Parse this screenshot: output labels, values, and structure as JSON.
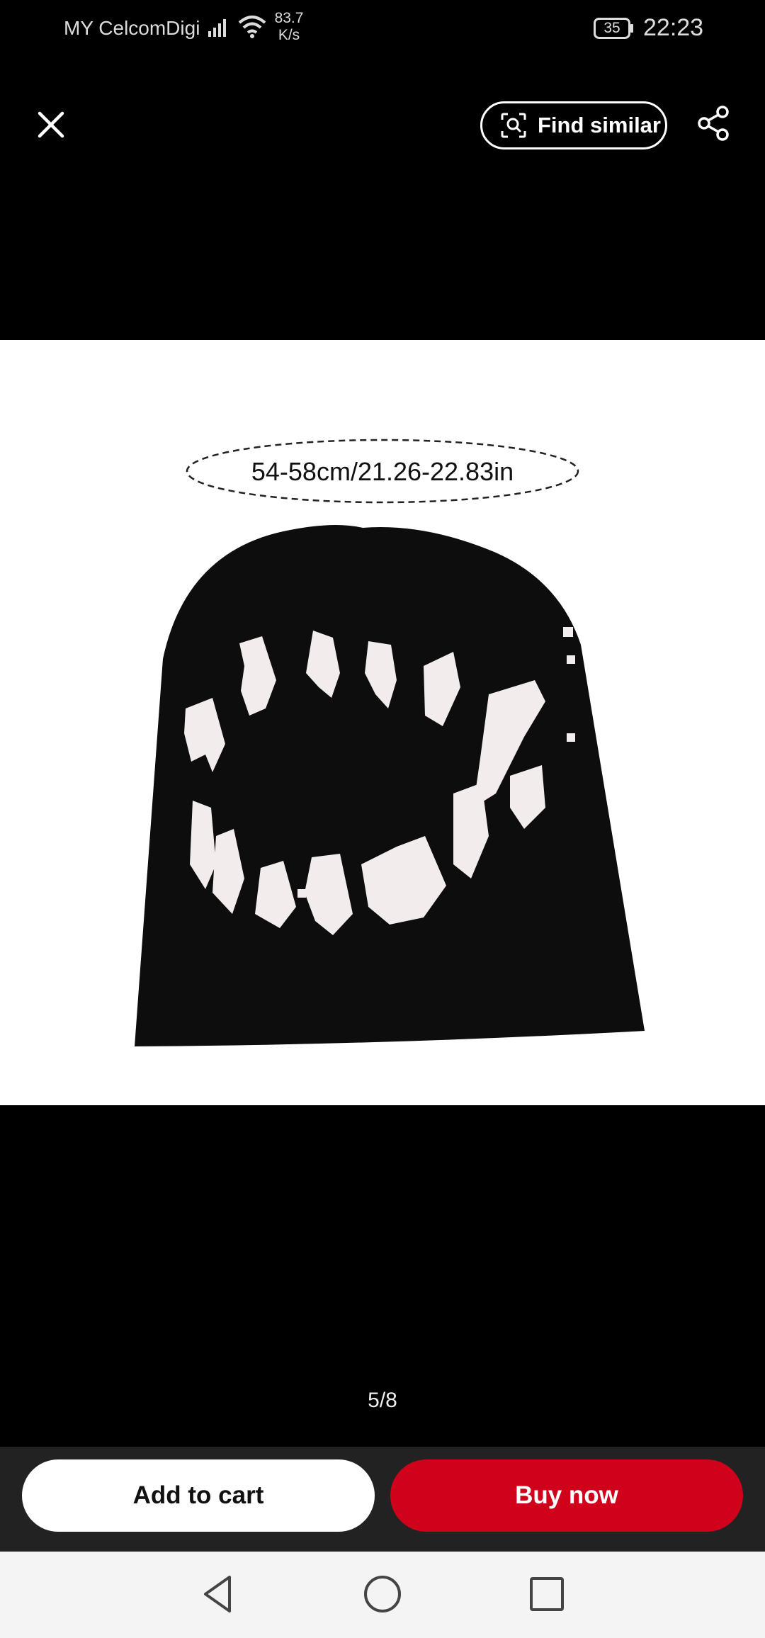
{
  "status_bar": {
    "carrier": "MY CelcomDigi",
    "speed_value": "83.7",
    "speed_unit": "K/s",
    "battery": "35",
    "time": "22:23",
    "icons": [
      "signal-icon",
      "wifi-icon",
      "battery-icon"
    ]
  },
  "toolbar": {
    "close_icon": "close-icon",
    "find_similar_label": "Find similar",
    "find_similar_icon": "scan-search-icon",
    "share_icon": "share-icon"
  },
  "image": {
    "size_label": "54-58cm/21.26-22.83in"
  },
  "gallery": {
    "counter": "5/8"
  },
  "actions": {
    "add_to_cart": "Add to cart",
    "buy_now": "Buy now",
    "buy_color": "#d0011b"
  },
  "nav": {
    "icons": [
      "back-icon",
      "home-icon",
      "recents-icon"
    ]
  }
}
